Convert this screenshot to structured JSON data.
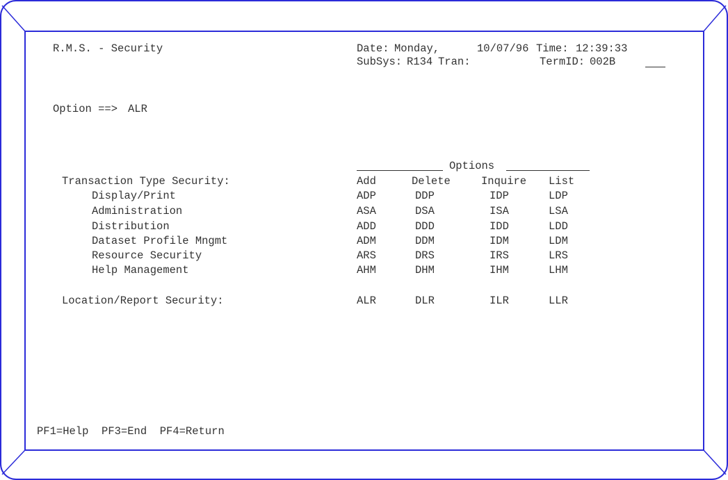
{
  "header": {
    "title": "R.M.S. - Security",
    "date_label": "Date:",
    "day": "Monday,",
    "date": "10/07/96",
    "time_label": "Time:",
    "time": "12:39:33",
    "subsys_label": "SubSys:",
    "subsys": "R134",
    "tran_label": "Tran:",
    "termid_label": "TermID:",
    "termid": "002B"
  },
  "option": {
    "label": "Option ==>",
    "value": "ALR"
  },
  "options_header": "Options",
  "columns": [
    "Add",
    "Delete",
    "Inquire",
    "List"
  ],
  "transaction_section": {
    "label": "Transaction Type Security:",
    "rows": [
      {
        "label": "Display/Print",
        "codes": [
          "ADP",
          "DDP",
          "IDP",
          "LDP"
        ]
      },
      {
        "label": "Administration",
        "codes": [
          "ASA",
          "DSA",
          "ISA",
          "LSA"
        ]
      },
      {
        "label": "Distribution",
        "codes": [
          "ADD",
          "DDD",
          "IDD",
          "LDD"
        ]
      },
      {
        "label": "Dataset Profile Mngmt",
        "codes": [
          "ADM",
          "DDM",
          "IDM",
          "LDM"
        ]
      },
      {
        "label": "Resource Security",
        "codes": [
          "ARS",
          "DRS",
          "IRS",
          "LRS"
        ]
      },
      {
        "label": "Help Management",
        "codes": [
          "AHM",
          "DHM",
          "IHM",
          "LHM"
        ]
      }
    ]
  },
  "location_section": {
    "label": "Location/Report Security:",
    "codes": [
      "ALR",
      "DLR",
      "ILR",
      "LLR"
    ]
  },
  "footer": {
    "pf_keys": "PF1=Help  PF3=End  PF4=Return"
  },
  "colors": {
    "frame": "#2b2bd9",
    "text": "#333333"
  }
}
